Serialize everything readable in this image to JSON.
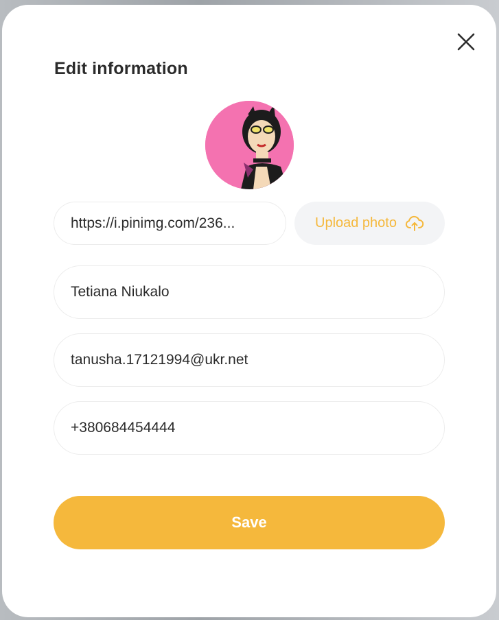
{
  "modal": {
    "title": "Edit information",
    "close_icon": "close-icon"
  },
  "avatar": {
    "background_color": "#f472b0",
    "description_icon": "avatar-image"
  },
  "form": {
    "photo_url": {
      "value": "https://i.pinimg.com/236..."
    },
    "upload_button": {
      "label": "Upload photo",
      "icon": "upload-cloud-icon",
      "color": "#f5b83c"
    },
    "name": {
      "value": "Tetiana Niukalo"
    },
    "email": {
      "value": "tanusha.17121994@ukr.net"
    },
    "phone": {
      "value": "+380684454444"
    },
    "save_button": {
      "label": "Save",
      "color": "#f5b83c"
    }
  }
}
